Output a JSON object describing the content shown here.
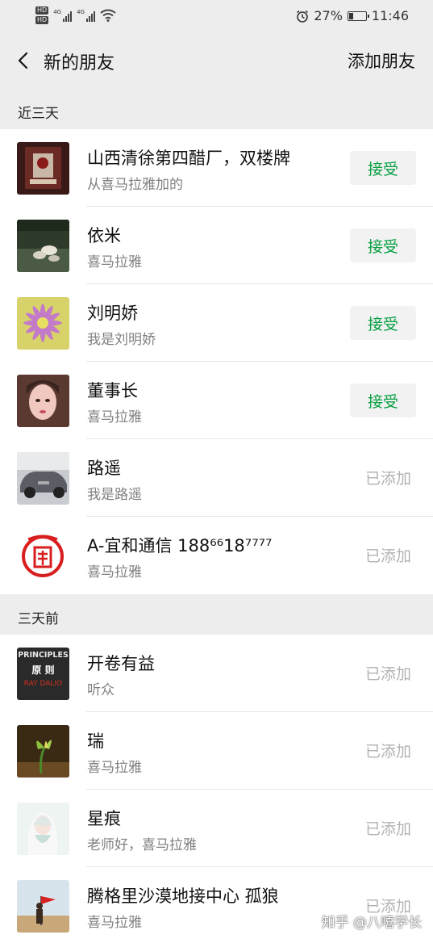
{
  "status": {
    "network1": "4G",
    "network2": "4G",
    "hd": "HD",
    "battery": "27%",
    "battery_level": 0.27,
    "time": "11:46"
  },
  "header": {
    "title": "新的朋友",
    "action": "添加朋友"
  },
  "sections": [
    {
      "label": "近三天",
      "items": [
        {
          "name": "山西清徐第四醋厂，双楼牌",
          "sub": "从喜马拉雅加的",
          "state": "accept",
          "button": "接受"
        },
        {
          "name": "依米",
          "sub": "喜马拉雅",
          "state": "accept",
          "button": "接受"
        },
        {
          "name": "刘明娇",
          "sub": "我是刘明娇",
          "state": "accept",
          "button": "接受"
        },
        {
          "name": "董事长",
          "sub": "喜马拉雅",
          "state": "accept",
          "button": "接受"
        },
        {
          "name": "路遥",
          "sub": "我是路遥",
          "state": "added",
          "button": "已添加"
        },
        {
          "name": "A-宜和通信 188⁶⁶18⁷⁷⁷⁷",
          "sub": "喜马拉雅",
          "state": "added",
          "button": "已添加"
        }
      ]
    },
    {
      "label": "三天前",
      "items": [
        {
          "name": "开卷有益",
          "sub": "听众",
          "state": "added",
          "button": "已添加"
        },
        {
          "name": "瑞",
          "sub": "喜马拉雅",
          "state": "added",
          "button": "已添加"
        },
        {
          "name": "星痕",
          "sub": "老师好，喜马拉雅",
          "state": "added",
          "button": "已添加"
        },
        {
          "name": "腾格里沙漠地接中心 孤狼",
          "sub": "喜马拉雅",
          "state": "added",
          "button": "已添加"
        }
      ]
    }
  ],
  "avatar_texts": {
    "principles_top": "PRINCIPLES",
    "principles_mid": "原 则",
    "principles_bottom": "RAY DALIO"
  },
  "watermark": "知乎 @八嘻学长",
  "colors": {
    "accept_text": "#07a043",
    "accept_bg": "#f2f2f2",
    "added_text": "#b2b2b2",
    "background": "#ededed"
  }
}
